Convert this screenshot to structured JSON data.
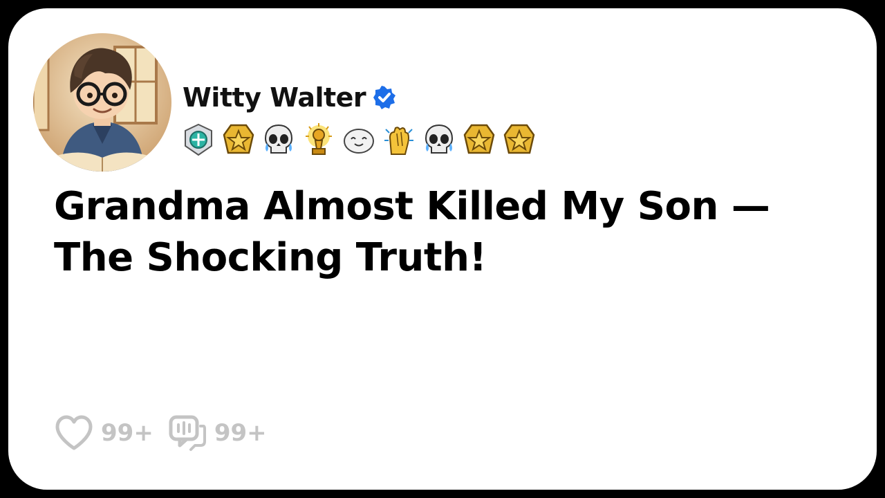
{
  "author": {
    "name": "Witty Walter",
    "verified": true,
    "verified_color": "#1d6ee8",
    "avatar": "cartoon-boy-with-glasses-reading-book"
  },
  "badges": [
    "emerald-shield-award-icon",
    "gold-star-medal-icon",
    "crying-skull-icon",
    "gold-trophy-award-icon",
    "smiling-seal-icon",
    "clapping-hands-icon",
    "crying-skull-icon",
    "gold-star-medal-icon",
    "gold-star-medal-icon"
  ],
  "post": {
    "title": "Grandma Almost Killed My Son — The Shocking Truth!"
  },
  "engagement": {
    "likes": "99+",
    "comments": "99+",
    "likes_icon": "heart-icon",
    "comments_icon": "comment-bubble-icon",
    "color": "#c4c4c4"
  },
  "colors": {
    "border": "#000000",
    "card_background": "#ffffff",
    "title": "#000000",
    "muted": "#c4c4c4"
  }
}
